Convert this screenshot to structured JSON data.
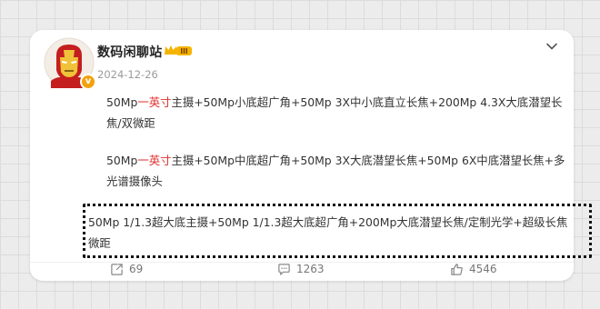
{
  "post": {
    "author": "数码闲聊站",
    "badge_label": "III",
    "timestamp": "2024-12-26",
    "para1": {
      "pre": "50Mp",
      "highlight": "一英寸",
      "post": "主摄+50Mp小底超广角+50Mp 3X中小底直立长焦+200Mp 4.3X大底潜望长焦/双微距"
    },
    "para2": {
      "pre": "50Mp",
      "highlight": "一英寸",
      "post": "主摄+50Mp中底超广角+50Mp 3X大底潜望长焦+50Mp 6X中底潜望长焦+多光谱摄像头"
    },
    "para3": "50Mp 1/1.3超大底主摄+50Mp 1/1.3超大底超广角+200Mp大底潜望长焦/定制光学+超级长焦微距",
    "actions": {
      "repost_count": "69",
      "comment_count": "1263",
      "like_count": "4546"
    }
  },
  "icons": {
    "avatar": "iron-man-avatar",
    "verified": "verified-badge-icon",
    "rank": "crown-rank-badge-icon",
    "menu": "chevron-down-icon",
    "repost": "repost-icon",
    "comment": "comment-icon",
    "like": "thumbs-up-icon"
  },
  "colors": {
    "highlight": "#e0312e",
    "verified": "#f2a20f",
    "rank_badge": "#f5b400"
  }
}
